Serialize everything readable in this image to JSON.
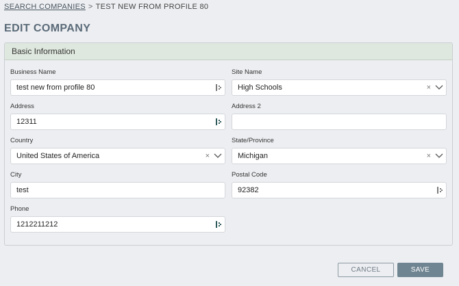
{
  "breadcrumb": {
    "link_label": "SEARCH COMPANIES",
    "separator": ">",
    "current": "TEST NEW FROM PROFILE 80"
  },
  "page": {
    "title": "EDIT COMPANY"
  },
  "panel": {
    "title": "Basic Information"
  },
  "fields": {
    "business_name": {
      "label": "Business Name",
      "value": "test new from profile 80"
    },
    "site_name": {
      "label": "Site Name",
      "value": "High Schools"
    },
    "address": {
      "label": "Address",
      "value": "12311"
    },
    "address2": {
      "label": "Address 2",
      "value": ""
    },
    "country": {
      "label": "Country",
      "value": "United States of America"
    },
    "state": {
      "label": "State/Province",
      "value": "Michigan"
    },
    "city": {
      "label": "City",
      "value": "test"
    },
    "postal_code": {
      "label": "Postal Code",
      "value": "92382"
    },
    "phone": {
      "label": "Phone",
      "value": "1212211212"
    }
  },
  "icons": {
    "clear": "×",
    "keypass": "password-manager-icon",
    "chevron": "chevron-down-icon"
  },
  "buttons": {
    "cancel": "CANCEL",
    "save": "SAVE"
  },
  "colors": {
    "accent": "#6f8591",
    "panel_header": "#dfe8de",
    "title": "#5a6a78"
  }
}
